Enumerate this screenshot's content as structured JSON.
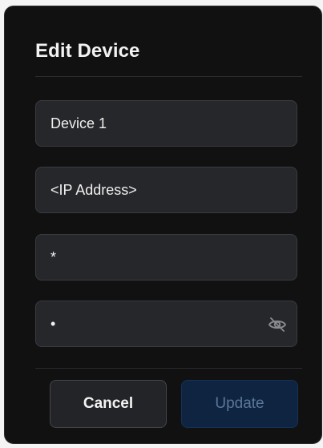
{
  "dialog": {
    "title": "Edit Device"
  },
  "fields": {
    "name": {
      "value": "Device 1"
    },
    "ip": {
      "value": "<IP Address>"
    },
    "username": {
      "value": "*"
    },
    "password": {
      "value": "•"
    },
    "password_toggle_icon": "eye-off-icon"
  },
  "buttons": {
    "cancel": "Cancel",
    "update": "Update"
  },
  "colors": {
    "dialog_bg": "#111112",
    "field_bg": "#26272a",
    "update_bg": "#0f2440",
    "update_text": "#5b7799"
  }
}
